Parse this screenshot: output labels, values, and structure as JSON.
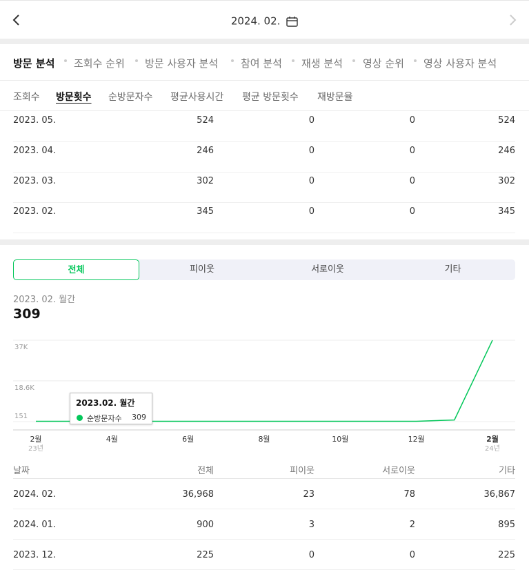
{
  "header": {
    "date": "2024. 02."
  },
  "tabs_main": [
    "방문 분석",
    "조회수 순위",
    "방문 사용자 분석",
    "참여 분석",
    "재생 분석",
    "영상 순위",
    "영상 사용자 분석"
  ],
  "tabs_sub": [
    "조회수",
    "방문횟수",
    "순방문자수",
    "평균사용시간",
    "평균 방문횟수",
    "재방문율"
  ],
  "top_table": [
    [
      "2023. 05.",
      "524",
      "0",
      "0",
      "524"
    ],
    [
      "2023. 04.",
      "246",
      "0",
      "0",
      "246"
    ],
    [
      "2023. 03.",
      "302",
      "0",
      "0",
      "302"
    ],
    [
      "2023. 02.",
      "345",
      "0",
      "0",
      "345"
    ]
  ],
  "segments": [
    "전체",
    "피이웃",
    "서로이웃",
    "기타"
  ],
  "period_label": "2023. 02. 월간",
  "big_value": "309",
  "tooltip": {
    "title": "2023.02. 월간",
    "series": "순방문자수",
    "value": "309"
  },
  "accent_color": "#03c75a",
  "chart_data": {
    "type": "line",
    "x": [
      "2023-02",
      "2023-03",
      "2023-04",
      "2023-05",
      "2023-06",
      "2023-07",
      "2023-08",
      "2023-09",
      "2023-10",
      "2023-11",
      "2023-12",
      "2024-01",
      "2024-02"
    ],
    "values": [
      309,
      309,
      309,
      309,
      309,
      309,
      309,
      309,
      309,
      309,
      309,
      900,
      36968
    ],
    "yticks": [
      "151",
      "18.6K",
      "37K"
    ],
    "ytick_values": [
      151,
      18600,
      37000
    ],
    "xtick_labels": [
      "2월",
      "4월",
      "6월",
      "8월",
      "10월",
      "12월",
      "2월"
    ],
    "xtick_sub": [
      "23년",
      "",
      "",
      "",
      "",
      "",
      "24년"
    ],
    "xtick_index": [
      0,
      2,
      4,
      6,
      8,
      10,
      12
    ],
    "ylim": [
      151,
      37000
    ],
    "line_color": "#03c75a",
    "grid": true
  },
  "bottom_table": {
    "headers": [
      "날짜",
      "전체",
      "피이웃",
      "서로이웃",
      "기타"
    ],
    "rows": [
      [
        "2024. 02.",
        "36,968",
        "23",
        "78",
        "36,867"
      ],
      [
        "2024. 01.",
        "900",
        "3",
        "2",
        "895"
      ],
      [
        "2023. 12.",
        "225",
        "0",
        "0",
        "225"
      ]
    ]
  }
}
